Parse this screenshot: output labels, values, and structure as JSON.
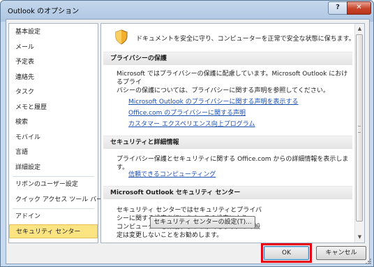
{
  "window": {
    "title": "Outlook のオプション",
    "help_label": "?",
    "close_label": "✕"
  },
  "sidebar": {
    "items": [
      {
        "label": "基本設定"
      },
      {
        "label": "メール"
      },
      {
        "label": "予定表"
      },
      {
        "label": "連絡先"
      },
      {
        "label": "タスク"
      },
      {
        "label": "メモと履歴"
      },
      {
        "label": "検索"
      },
      {
        "label": "モバイル"
      },
      {
        "label": "言語"
      },
      {
        "label": "詳細設定"
      },
      {
        "label": "リボンのユーザー設定"
      },
      {
        "label": "クイック アクセス ツール バー"
      },
      {
        "label": "アドイン"
      },
      {
        "label": "セキュリティ センター"
      }
    ],
    "selected": "セキュリティ センター"
  },
  "main": {
    "intro": "ドキュメントを安全に守り、コンピューターを正常で安全な状態に保ちます。",
    "privacy": {
      "heading": "プライバシーの保護",
      "line1": "Microsoft ではプライバシーの保護に配慮しています。Microsoft Outlook におけるプライ",
      "line2": "バシーの保護については、プライバシーに関する声明を参照してください。",
      "links": [
        "Microsoft Outlook のプライバシーに関する声明を表示する",
        "Office.com のプライバシーに関する声明",
        "カスタマー エクスペリエンス向上プログラム"
      ]
    },
    "security": {
      "heading": "セキュリティと詳細情報",
      "text": "プライバシー保護とセキュリティに関する Office.com からの詳細情報を表示します。",
      "link": "信頼できるコンピューティング"
    },
    "trust_center": {
      "heading": "Microsoft Outlook セキュリティ センター",
      "lines": [
        "セキュリティ センターではセキュリティとプライバ",
        "シーに関する設定を行います。この設定により、",
        "コンピューターを保護することができます。この設",
        "定は変更しないことをお勧めします。"
      ],
      "button": "セキュリティ センターの設定(T)..."
    }
  },
  "footer": {
    "ok": "OK",
    "cancel": "キャンセル"
  },
  "colors": {
    "selected_bg": "#fbe481",
    "link": "#1a4fb3",
    "highlight_frame": "#e60012"
  }
}
